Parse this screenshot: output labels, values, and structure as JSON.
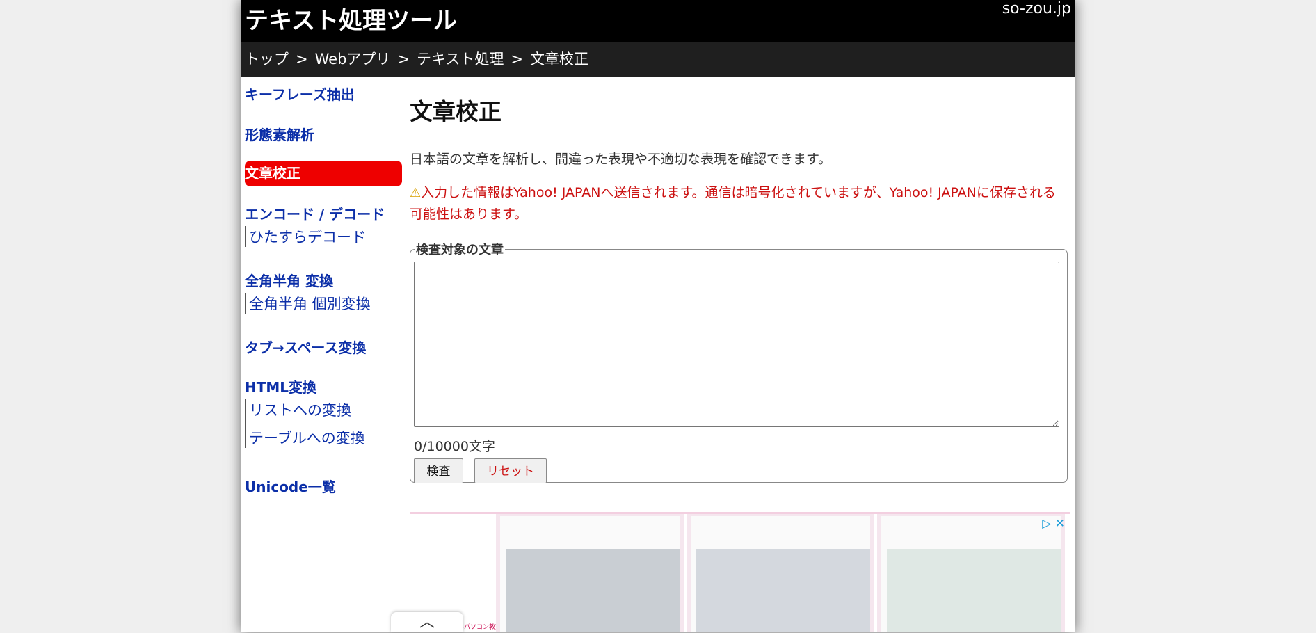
{
  "header": {
    "site_title": "テキスト処理ツール",
    "site_domain": "so-zou.jp"
  },
  "breadcrumb": {
    "items": [
      "トップ",
      "Webアプリ",
      "テキスト処理",
      "文章校正"
    ],
    "separator": ">"
  },
  "sidebar": {
    "keyphrase": "キーフレーズ抽出",
    "morph": "形態素解析",
    "proofread": "文章校正",
    "encode": "エンコード / デコード",
    "encode_sub": "ひたすらデコード",
    "zenhan": "全角半角 変換",
    "zenhan_sub": "全角半角 個別変換",
    "tab": "タブ→スペース変換",
    "html": "HTML変換",
    "html_sub1": "リストへの変換",
    "html_sub2": "テーブルへの変換",
    "unicode": "Unicode一覧"
  },
  "main": {
    "title": "文章校正",
    "description": "日本語の文章を解析し、間違った表現や不適切な表現を確認できます。",
    "warning": "入力した情報はYahoo! JAPANへ送信されます。通信は暗号化されていますが、Yahoo! JAPANに保存される可能性はあります。",
    "form": {
      "legend": "検査対象の文章",
      "textarea_value": "",
      "char_count": "0/10000文字",
      "check_label": "検査",
      "reset_label": "リセット"
    }
  },
  "ad": {
    "left_text": "仕事と資格に強いパソコン教室",
    "choices_label": "▷ ✕"
  },
  "scroll_up": "︿",
  "colors": {
    "header_bg": "#000000",
    "breadcrumb_bg": "#1f1f1f",
    "link": "#0c2fa8",
    "active_bg": "#ee0000",
    "warning": "#cc1111"
  }
}
